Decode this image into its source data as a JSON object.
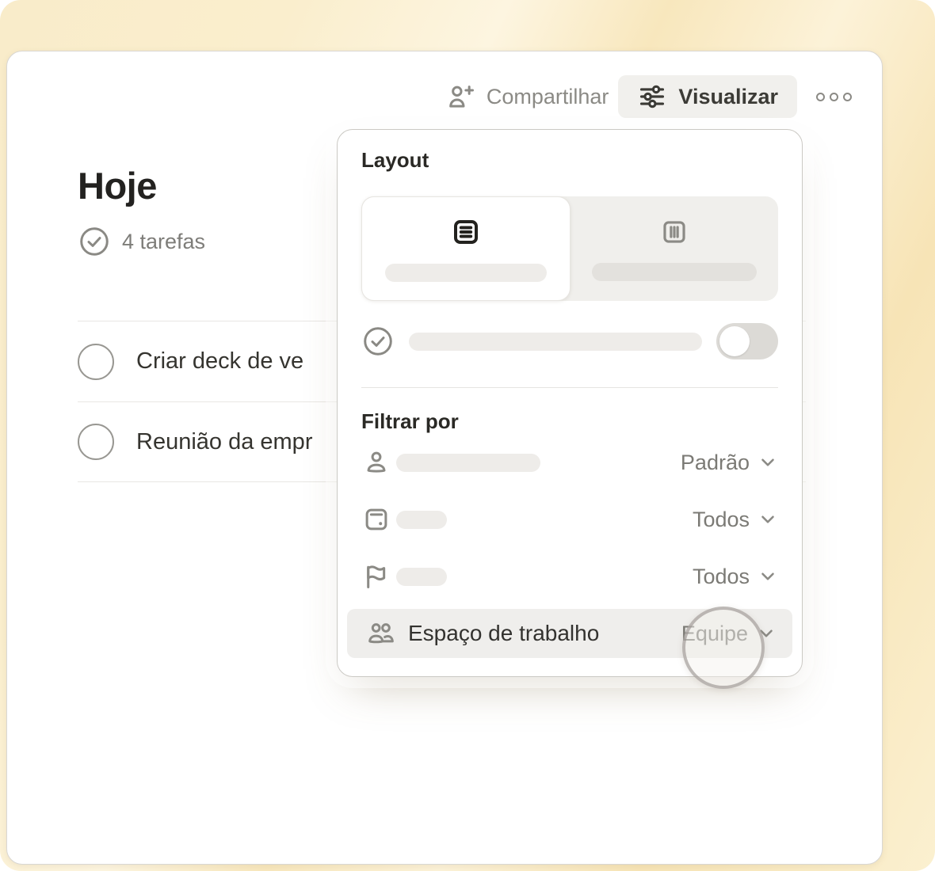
{
  "header": {
    "share_label": "Compartilhar",
    "view_label": "Visualizar",
    "icons": {
      "share": "person-plus-icon",
      "view": "sliders-icon",
      "more": "more-dots-icon"
    }
  },
  "page": {
    "title": "Hoje",
    "task_count": "4 tarefas",
    "count_icon": "check-circle-icon"
  },
  "tasks": [
    {
      "label": "Criar deck de ve",
      "state": "open"
    },
    {
      "label": "Reunião da empr",
      "state": "open"
    }
  ],
  "popover": {
    "layout_heading": "Layout",
    "layout_options": [
      {
        "name": "list",
        "icon": "list-layout-icon",
        "selected": true
      },
      {
        "name": "board",
        "icon": "board-layout-icon",
        "selected": false
      }
    ],
    "toggle": {
      "icon": "check-circle-icon",
      "state": "off"
    },
    "filter_heading": "Filtrar por",
    "filters": [
      {
        "icon": "person-icon",
        "label": "",
        "value": "Padrão"
      },
      {
        "icon": "calendar-icon",
        "label": "",
        "value": "Todos"
      },
      {
        "icon": "flag-icon",
        "label": "",
        "value": "Todos"
      },
      {
        "icon": "people-icon",
        "label": "Espaço de trabalho",
        "value": "Equipe",
        "highlighted": true
      }
    ]
  },
  "colors": {
    "backdrop_cream": "#f9ecca",
    "card_white": "#ffffff",
    "button_gray": "#f1f0ed",
    "highlight_row": "#efeeec",
    "muted_text": "#7e7d79",
    "dark_text": "#2a2925",
    "placeholder_bar": "#eeece9",
    "toggle_track": "#dcdad6"
  }
}
